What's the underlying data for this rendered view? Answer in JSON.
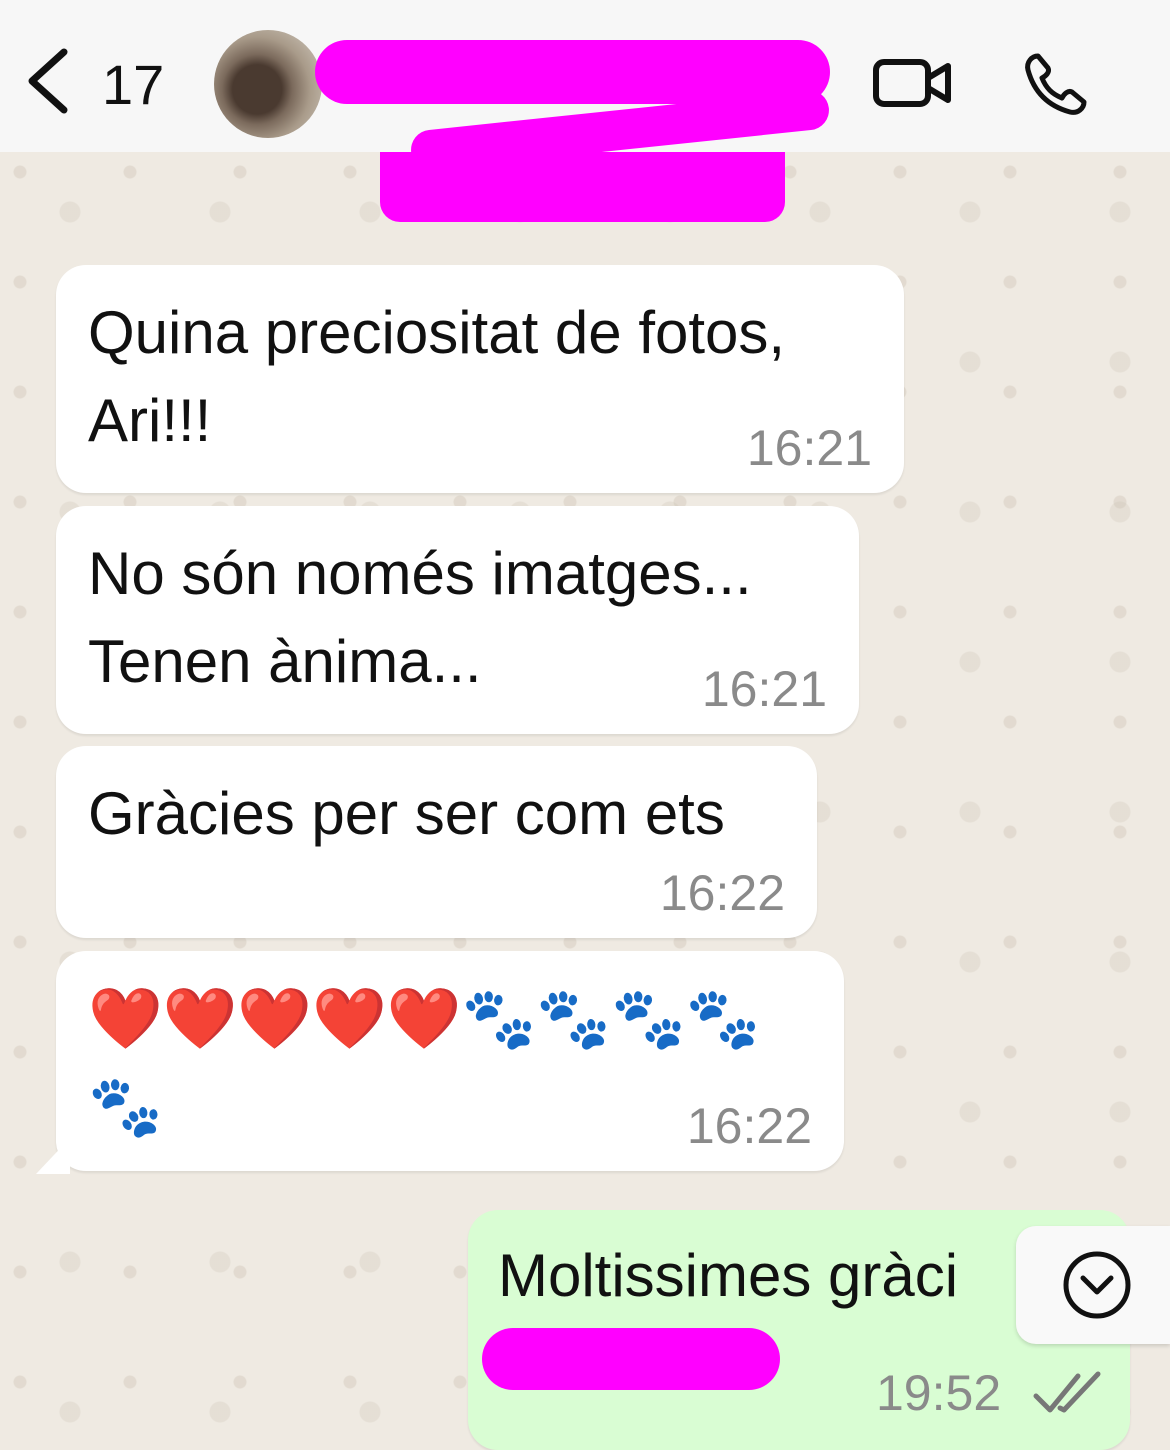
{
  "header": {
    "unread_count": "17",
    "contact_name": "",
    "back_icon": "chevron-left-icon",
    "video_icon": "video-camera-icon",
    "phone_icon": "phone-icon"
  },
  "messages": [
    {
      "direction": "incoming",
      "text": "Quina preciositat de fotos,\nAri!!!",
      "time": "16:21"
    },
    {
      "direction": "incoming",
      "text": "No són només imatges...\nTenen ànima...",
      "time": "16:21"
    },
    {
      "direction": "incoming",
      "text": "Gràcies per ser com ets",
      "time": "16:22"
    },
    {
      "direction": "incoming",
      "text": "❤️❤️❤️❤️❤️🐾🐾🐾🐾\n🐾",
      "time": "16:22"
    },
    {
      "direction": "outgoing",
      "text": "Moltissimes gràci",
      "time": "19:52",
      "status": "read"
    }
  ],
  "colors": {
    "outgoing_bubble": "#d9fdd3",
    "incoming_bubble": "#ffffff",
    "redaction": "#ff00ff"
  },
  "scroll_down_icon": "chevron-down-circle-icon"
}
